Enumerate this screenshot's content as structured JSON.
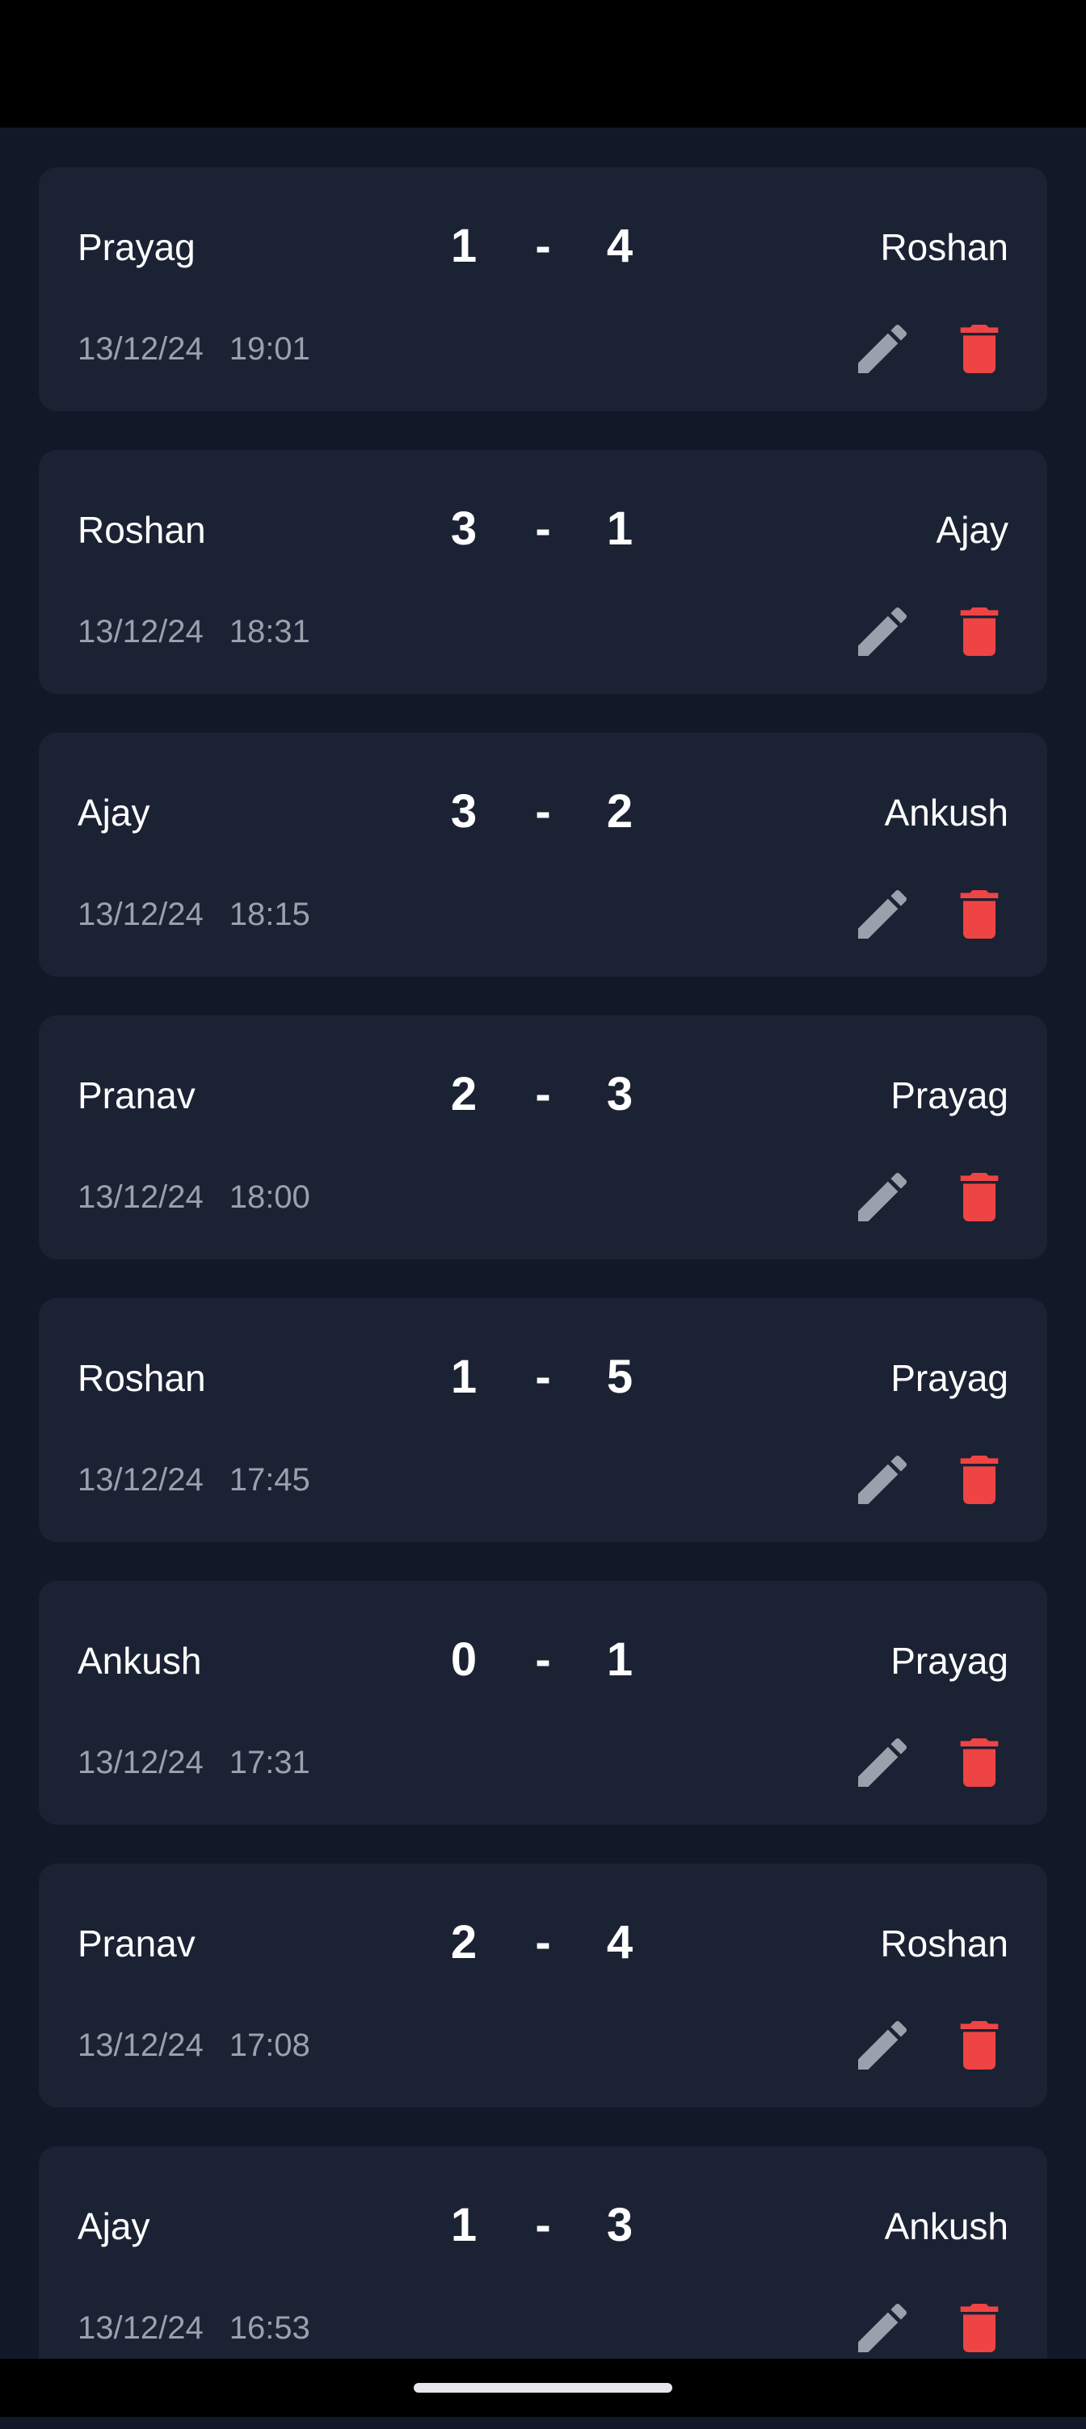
{
  "colors": {
    "background": "#111827",
    "card": "#1b2233",
    "text": "#ffffff",
    "muted": "#9aa1ad",
    "edit_icon": "#9aa1ad",
    "delete_icon": "#ef4444"
  },
  "icons": {
    "edit": "pencil-icon",
    "delete": "trash-icon"
  },
  "matches": [
    {
      "player1": "Prayag",
      "score1": "1",
      "separator": "-",
      "score2": "4",
      "player2": "Roshan",
      "date": "13/12/24",
      "time": "19:01"
    },
    {
      "player1": "Roshan",
      "score1": "3",
      "separator": "-",
      "score2": "1",
      "player2": "Ajay",
      "date": "13/12/24",
      "time": "18:31"
    },
    {
      "player1": "Ajay",
      "score1": "3",
      "separator": "-",
      "score2": "2",
      "player2": "Ankush",
      "date": "13/12/24",
      "time": "18:15"
    },
    {
      "player1": "Pranav",
      "score1": "2",
      "separator": "-",
      "score2": "3",
      "player2": "Prayag",
      "date": "13/12/24",
      "time": "18:00"
    },
    {
      "player1": "Roshan",
      "score1": "1",
      "separator": "-",
      "score2": "5",
      "player2": "Prayag",
      "date": "13/12/24",
      "time": "17:45"
    },
    {
      "player1": "Ankush",
      "score1": "0",
      "separator": "-",
      "score2": "1",
      "player2": "Prayag",
      "date": "13/12/24",
      "time": "17:31"
    },
    {
      "player1": "Pranav",
      "score1": "2",
      "separator": "-",
      "score2": "4",
      "player2": "Roshan",
      "date": "13/12/24",
      "time": "17:08"
    },
    {
      "player1": "Ajay",
      "score1": "1",
      "separator": "-",
      "score2": "3",
      "player2": "Ankush",
      "date": "13/12/24",
      "time": "16:53"
    }
  ]
}
